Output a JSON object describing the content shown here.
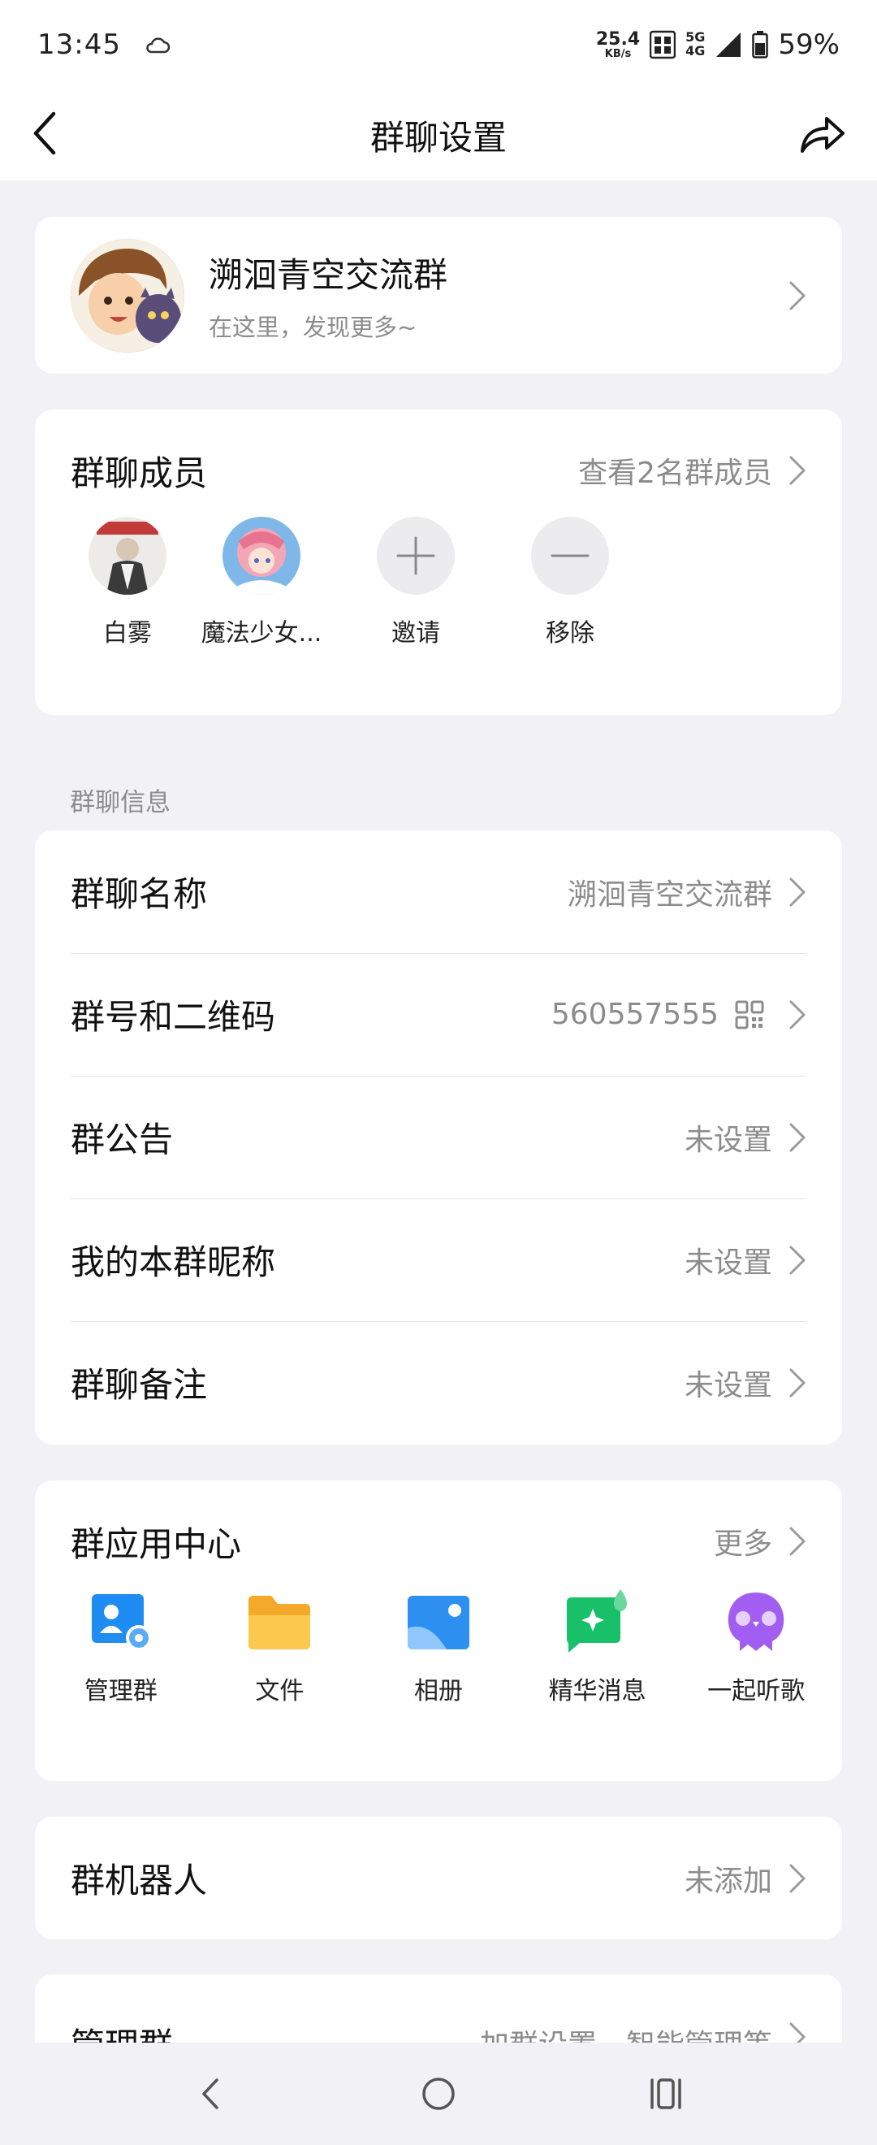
{
  "status_bar": {
    "time": "13:45",
    "net_speed_value": "25.4",
    "net_speed_unit": "KB/s",
    "network_5g": "5G",
    "network_4g": "4G",
    "battery": "59%"
  },
  "nav": {
    "title": "群聊设置"
  },
  "group": {
    "name": "溯洄青空交流群",
    "description": "在这里，发现更多~"
  },
  "members": {
    "title": "群聊成员",
    "view_all": "查看2名群成员",
    "items": [
      {
        "label": "白雾"
      },
      {
        "label": "魔法少女..."
      },
      {
        "label": "邀请"
      },
      {
        "label": "移除"
      }
    ]
  },
  "info_section": {
    "label": "群聊信息",
    "rows": [
      {
        "title": "群聊名称",
        "value": "溯洄青空交流群"
      },
      {
        "title": "群号和二维码",
        "value": "560557555"
      },
      {
        "title": "群公告",
        "value": "未设置"
      },
      {
        "title": "我的本群昵称",
        "value": "未设置"
      },
      {
        "title": "群聊备注",
        "value": "未设置"
      }
    ]
  },
  "apps": {
    "title": "群应用中心",
    "more": "更多",
    "items": [
      {
        "label": "管理群",
        "icon": "manage-group-icon",
        "color": "#1e8cf0"
      },
      {
        "label": "文件",
        "icon": "folder-icon",
        "color": "#f9b93a"
      },
      {
        "label": "相册",
        "icon": "photo-album-icon",
        "color": "#2d8ff0"
      },
      {
        "label": "精华消息",
        "icon": "essence-message-icon",
        "color": "#18c06a"
      },
      {
        "label": "一起听歌",
        "icon": "listen-together-icon",
        "color": "#a25ef0"
      }
    ]
  },
  "robot": {
    "title": "群机器人",
    "value": "未添加"
  },
  "manage": {
    "title": "管理群",
    "value": "加群设置、智能管理等"
  }
}
